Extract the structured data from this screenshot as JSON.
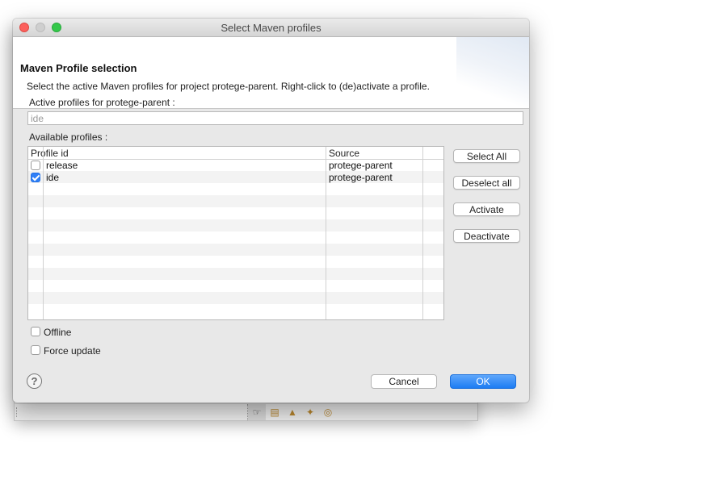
{
  "dialog": {
    "title": "Select Maven profiles",
    "header_title": "Maven Profile selection",
    "header_description": "Select the active Maven profiles for project protege-parent. Right-click to (de)activate a profile."
  },
  "active_profiles": {
    "label": "Active profiles for protege-parent :",
    "value": "ide"
  },
  "available_profiles": {
    "label": "Available profiles :",
    "columns": [
      "Profile id",
      "Source"
    ],
    "rows": [
      {
        "profile_id": "release",
        "source": "protege-parent",
        "checked": false
      },
      {
        "profile_id": "ide",
        "source": "protege-parent",
        "checked": true
      }
    ]
  },
  "side_buttons": {
    "select_all": "Select All",
    "deselect_all": "Deselect all",
    "activate": "Activate",
    "deactivate": "Deactivate"
  },
  "options": {
    "offline": "Offline",
    "force_update": "Force update"
  },
  "footer": {
    "help_glyph": "?",
    "cancel": "Cancel",
    "ok": "OK"
  },
  "colors": {
    "accent": "#1d7cf3",
    "close_button": "#fc605c",
    "zoom_button": "#34c84a"
  },
  "background_window": {
    "toolbar_icons": [
      "hand-icon",
      "map-icon",
      "graduation-cap-icon",
      "wand-icon",
      "help-lifebuoy-icon"
    ]
  }
}
